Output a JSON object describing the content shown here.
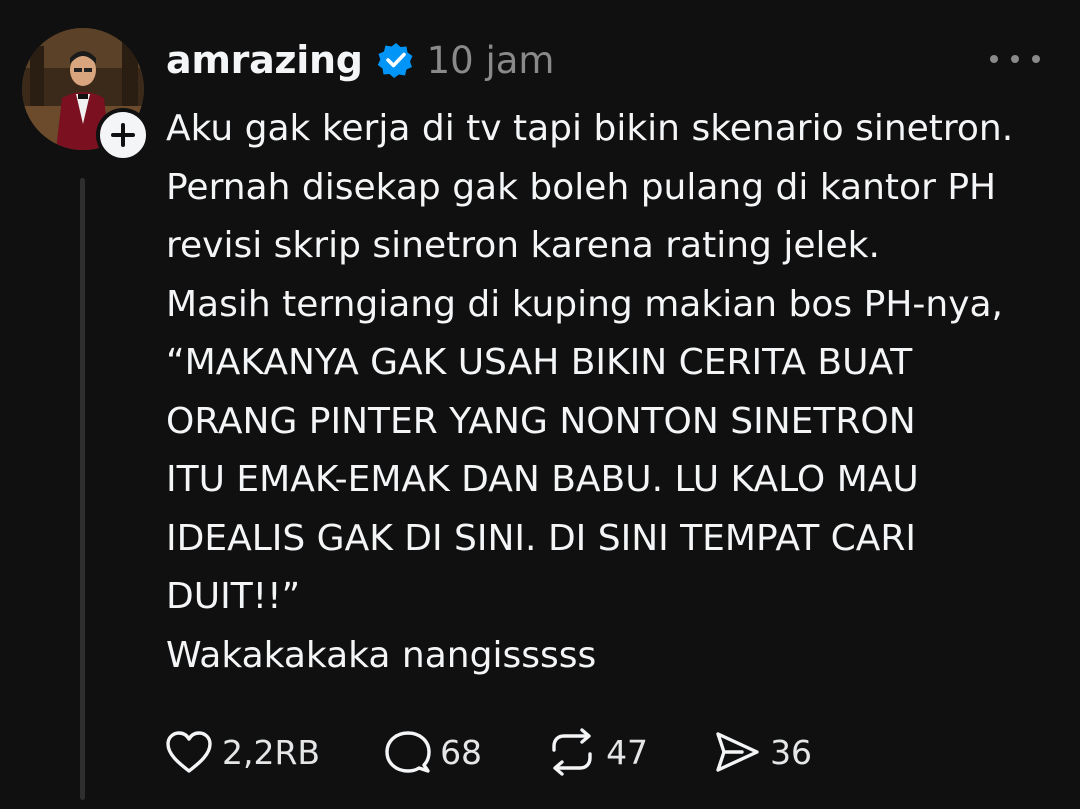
{
  "post": {
    "username": "amrazing",
    "timestamp": "10 jam",
    "verified": true,
    "text_lines": [
      "Aku gak kerja di tv tapi bikin skenario sinetron.",
      "Pernah disekap gak boleh pulang di kantor PH",
      "revisi skrip sinetron karena rating jelek.",
      "Masih terngiang di kuping makian bos PH-nya,",
      "“MAKANYA GAK USAH BIKIN CERITA BUAT",
      "ORANG PINTER YANG NONTON SINETRON",
      "ITU EMAK-EMAK DAN BABU. LU KALO MAU",
      "IDEALIS GAK DI SINI. DI SINI TEMPAT CARI",
      "DUIT!!”",
      "Wakakakaka nangisssss"
    ]
  },
  "actions": {
    "likes": "2,2RB",
    "comments": "68",
    "reposts": "47",
    "shares": "36"
  },
  "icons": {
    "like": "heart-icon",
    "comment": "comment-bubble-icon",
    "repost": "repost-icon",
    "share": "send-icon",
    "verified": "verified-badge-icon",
    "follow": "plus-icon",
    "more": "more-dots-icon"
  },
  "colors": {
    "background": "#101010",
    "text": "#f3f5f7",
    "muted": "#8a8a8a",
    "verified": "#0095f6",
    "thread_line": "#2e2e2e"
  }
}
